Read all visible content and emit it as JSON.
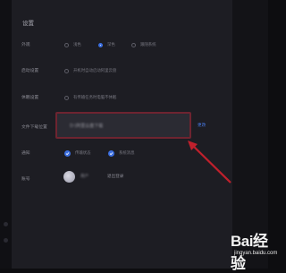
{
  "settings": {
    "title": "设置",
    "appearance": {
      "label": "外观",
      "options": [
        {
          "label": "浅色",
          "selected": false
        },
        {
          "label": "深色",
          "selected": true
        },
        {
          "label": "跟随系统",
          "selected": false
        }
      ]
    },
    "startup": {
      "label": "启动设置",
      "option": "开机时自动启动阿里云盘",
      "selected": false
    },
    "sleep": {
      "label": "休眠设置",
      "option": "有传输任务时电脑不休眠",
      "selected": false
    },
    "download_location": {
      "label": "文件下载位置",
      "path": "D:\\阿里云盘下载",
      "change_label": "更改"
    },
    "notifications": {
      "label": "通知",
      "options": [
        {
          "label": "传输状态",
          "checked": true
        },
        {
          "label": "系统消息",
          "checked": true
        }
      ]
    },
    "account": {
      "label": "账号",
      "nickname": "用户",
      "logout_label": "退出登录"
    }
  },
  "colors": {
    "accent": "#3c6fe0",
    "annotation": "#c0202c",
    "background": "#1d1d23"
  },
  "watermark": {
    "logo": "Bai经验",
    "url": "jingyan.baidu.com"
  }
}
